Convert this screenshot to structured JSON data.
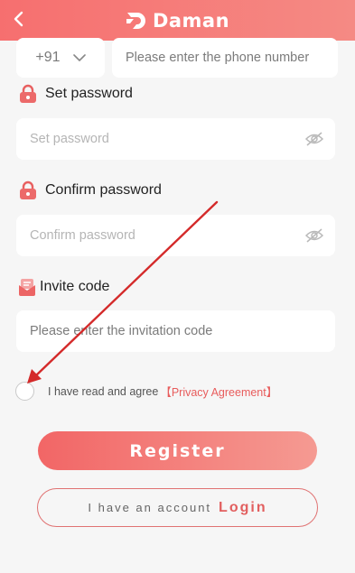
{
  "header": {
    "back_icon": "chevron-left-icon",
    "brand": "Daman",
    "brand_icon": "d-logo-icon",
    "color": "#f66f6f"
  },
  "phone": {
    "country_code": "+91",
    "dropdown_icon": "chevron-down-icon",
    "placeholder": "Please enter the phone number"
  },
  "set_password": {
    "label": "Set password",
    "icon": "lock-icon",
    "placeholder": "Set password",
    "toggle_icon": "eye-off-icon"
  },
  "confirm_password": {
    "label": "Confirm password",
    "icon": "lock-icon",
    "placeholder": "Confirm password",
    "toggle_icon": "eye-off-icon"
  },
  "invite": {
    "label": "Invite code",
    "icon": "invitation-icon",
    "placeholder": "Please enter the invitation code"
  },
  "agreement": {
    "text": "I have read and agree",
    "link": "【Privacy Agreement】",
    "checked": false
  },
  "register_label": "Register",
  "login": {
    "prompt": "I have an account",
    "link": "Login"
  },
  "colors": {
    "accent": "#e85c5c",
    "annotation_arrow": "#d42a2a",
    "background": "#f6f6f6"
  }
}
